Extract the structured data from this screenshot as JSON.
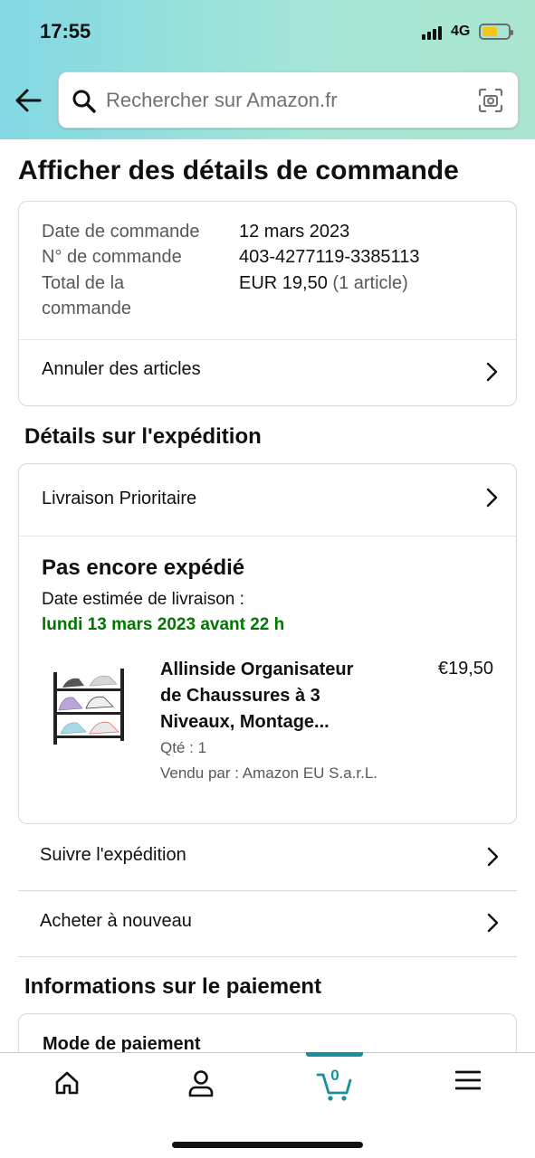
{
  "status_bar": {
    "time": "17:55",
    "network": "4G"
  },
  "search": {
    "placeholder": "Rechercher sur Amazon.fr"
  },
  "page_title": "Afficher des détails de commande",
  "order": {
    "date_label": "Date de commande",
    "date_value": "12 mars 2023",
    "number_label": "N° de commande",
    "number_value": "403-4277119-3385113",
    "total_label_line1": "Total de la",
    "total_label_line2": "commande",
    "total_value": "EUR 19,50",
    "total_count": "(1 article)",
    "cancel_label": "Annuler des articles"
  },
  "shipping": {
    "section_title": "Détails sur l'expédition",
    "delivery_type": "Livraison Prioritaire",
    "status": "Pas encore expédié",
    "estimate_label": "Date estimée de livraison :",
    "estimate_date": "lundi 13 mars 2023 avant 22 h",
    "product": {
      "title_line1": "Allinside Organisateur",
      "title_line2": "de Chaussures à 3",
      "title_line3": "Niveaux, Montage...",
      "price": "€19,50",
      "qty": "Qté : 1",
      "seller": "Vendu par : Amazon EU S.a.r.L."
    },
    "track_label": "Suivre l'expédition",
    "rebuy_label": "Acheter à nouveau"
  },
  "payment": {
    "section_title": "Informations sur le paiement",
    "method_label": "Mode de paiement"
  },
  "tabbar": {
    "cart_count": "0"
  },
  "colors": {
    "accent": "#178f9e",
    "delivery_green": "#007600",
    "battery": "#f5c518"
  }
}
